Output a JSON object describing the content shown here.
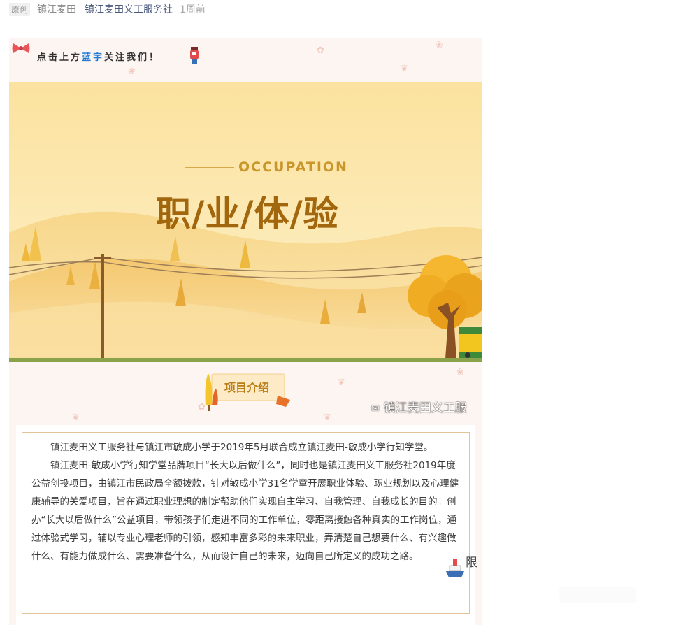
{
  "meta": {
    "original_badge": "原创",
    "author": "镇江麦田",
    "account": "镇江麦田义工服务社",
    "time": "1周前"
  },
  "header": {
    "text_prefix": "点击上方",
    "text_highlight": "蓝宇",
    "text_suffix": "关注我们！",
    "icons": [
      "bow-icon",
      "lantern-icon"
    ]
  },
  "banner": {
    "subtitle": "OCCUPATION",
    "title": "职/业/体/验",
    "colors": {
      "sky": "#fbe2a0",
      "title": "#a2660d",
      "subtitle": "#c9962c",
      "tree": "#f0b52e"
    }
  },
  "section": {
    "label": "项目介绍"
  },
  "watermark": {
    "icon": "wechat-icon",
    "text": "镇江麦田义工服"
  },
  "intro": {
    "paragraphs": [
      "镇江麦田义工服务社与镇江市敏成小学于2019年5月联合成立镇江麦田-敏成小学行知学堂。",
      "镇江麦田-敏成小学行知学堂品牌项目“长大以后做什么”，同时也是镇江麦田义工服务社2019年度公益创投项目，由镇江市民政局全额拨款，针对敏成小学31名学童开展职业体验、职业规划以及心理健康辅导的关爱项目，旨在通过职业理想的制定帮助他们实现自主学习、自我管理、自我成长的目的。创办“长大以后做什么”公益项目，带领孩子们走进不同的工作单位，零距离接触各种真实的工作岗位，通过体验式学习，辅以专业心理老师的引领，感知丰富多彩的未来职业，弄清楚自己想要什么、有兴趣做什么、有能力做成什么、需要准备什么，从而设计自己的未来，迈向自己所定义的成功之路。"
    ]
  },
  "footer": {
    "cut_text": "限"
  }
}
